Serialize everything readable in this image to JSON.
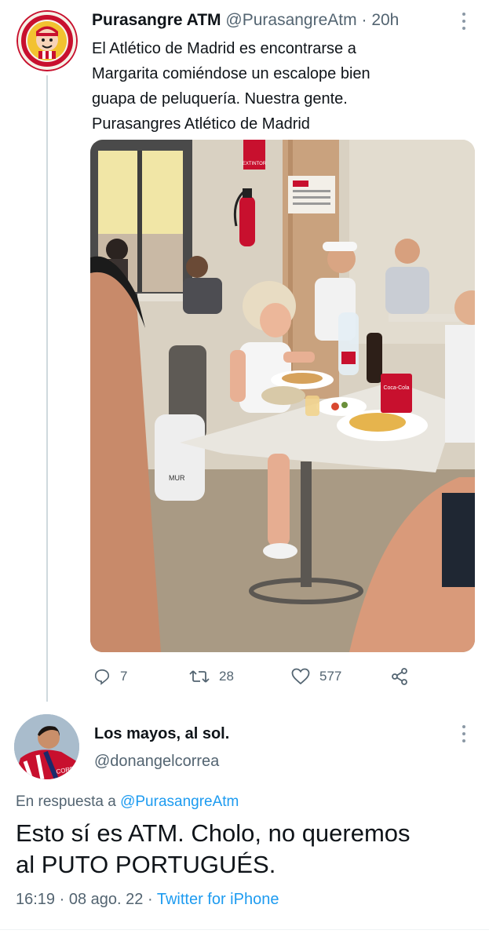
{
  "tweet": {
    "author_name": "Purasangre ATM",
    "author_handle": "@PurasangreAtm",
    "separator": "·",
    "time": "20h",
    "text_lines": [
      "El Atlético de Madrid es encontrarse a",
      "Margarita comiéndose un escalope bien",
      "guapa de peluquería. Nuestra gente.",
      "Purasangres Atlético de Madrid"
    ],
    "photo_text": {
      "sign": "EXTINTOR",
      "bag": "MUR",
      "can": "Coca-Cola"
    },
    "actions": {
      "replies": "7",
      "retweets": "28",
      "likes": "577"
    }
  },
  "reply": {
    "author_name": "Los mayos, al sol.",
    "author_handle": "@donangelcorrea",
    "replying_prefix": "En respuesta a",
    "replying_to": "@PurasangreAtm",
    "text_lines": [
      "Esto sí es ATM. Cholo, no queremos",
      "al PUTO PORTUGUÉS."
    ],
    "time": "16:19",
    "separator": "·",
    "date": "08 ago. 22",
    "source": "Twitter for iPhone",
    "avatar_jersey_text": "CORRE"
  },
  "colors": {
    "text": "#0f1419",
    "secondary": "#536471",
    "link": "#1d9bf0",
    "thread_line": "#cfd9de"
  },
  "icons": [
    "reply-icon",
    "retweet-icon",
    "like-icon",
    "share-icon",
    "more-icon"
  ]
}
